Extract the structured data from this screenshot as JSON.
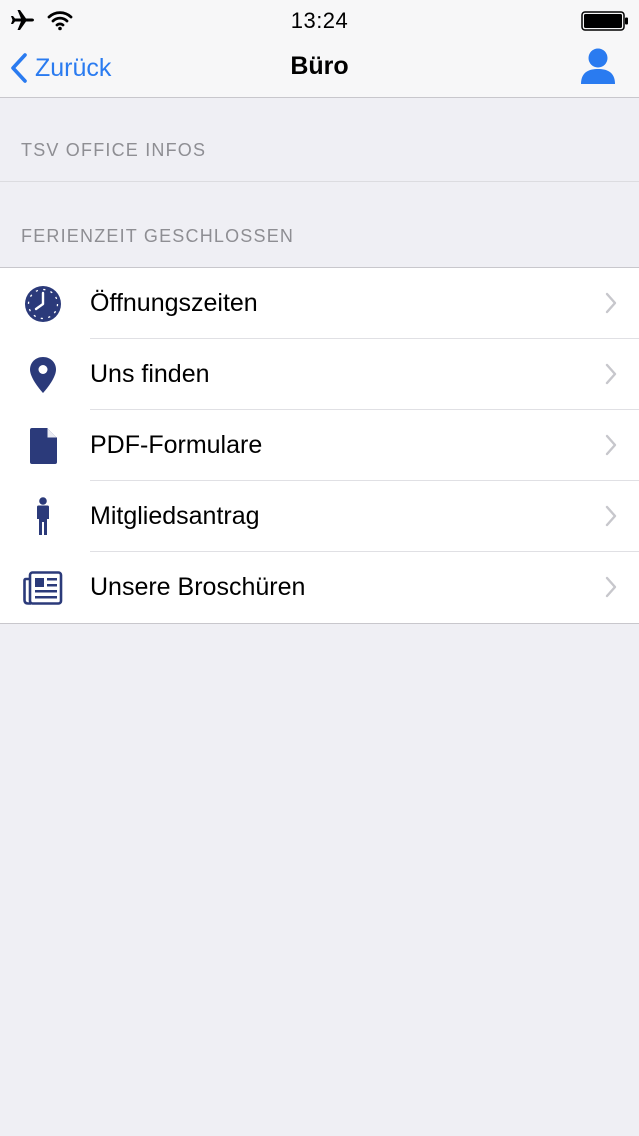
{
  "status_bar": {
    "time": "13:24",
    "icons": [
      "airplane-icon",
      "wifi-icon",
      "battery-icon"
    ]
  },
  "nav": {
    "back_label": "Zurück",
    "title": "Büro",
    "profile_icon": "person-icon"
  },
  "sections": [
    {
      "header": "TSV OFFICE INFOS"
    },
    {
      "header": "FERIENZEIT GESCHLOSSEN"
    }
  ],
  "items": [
    {
      "label": "Öffnungszeiten",
      "icon": "clock-icon"
    },
    {
      "label": "Uns finden",
      "icon": "location-pin-icon"
    },
    {
      "label": "PDF-Formulare",
      "icon": "document-icon"
    },
    {
      "label": "Mitgliedsantrag",
      "icon": "person-icon"
    },
    {
      "label": "Unsere Broschüren",
      "icon": "newspaper-icon"
    }
  ],
  "colors": {
    "accent": "#2a7bf0",
    "icon": "#2b3a7a",
    "background": "#efeff4",
    "chevron": "#c7c7cc"
  }
}
